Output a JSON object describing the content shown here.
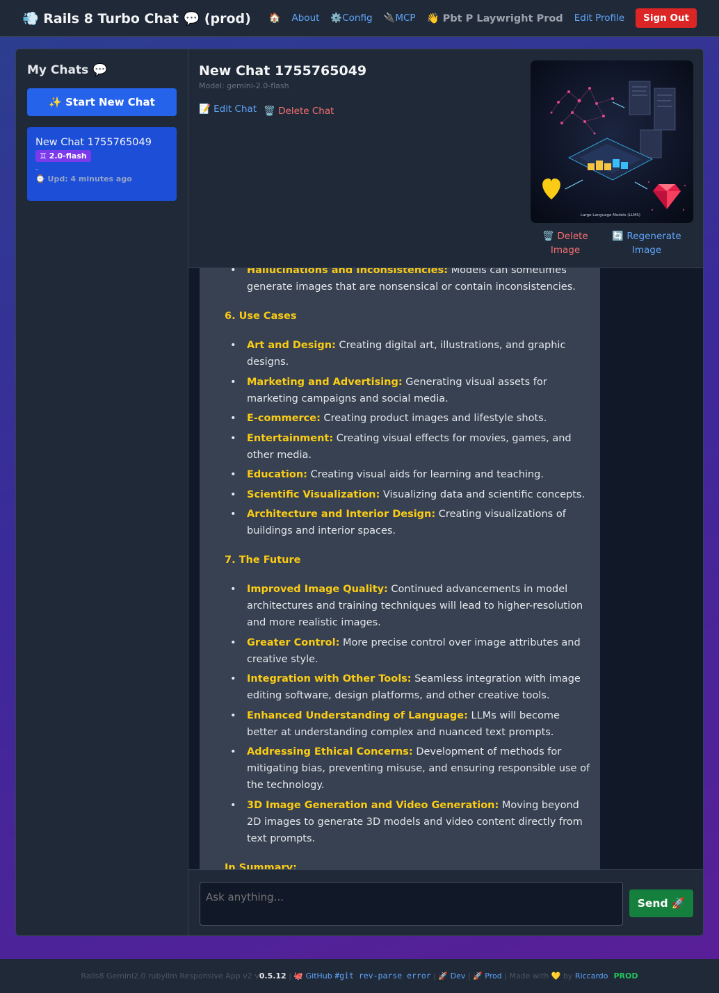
{
  "nav": {
    "brand": "💨 Rails 8 Turbo Chat 💬 (prod)",
    "home": "🏠",
    "about": "About",
    "config": "⚙️Config",
    "mcp": "🔌MCP",
    "user": "👋 Pbt P Laywright Prod",
    "edit_profile": "Edit Profile",
    "sign_out": "Sign Out"
  },
  "sidebar": {
    "title": "My Chats 💬",
    "new_chat": "✨ Start New Chat",
    "chats": [
      {
        "title": "New Chat 1755765049",
        "badge": "♊ 2.0-flash",
        "dash": "-",
        "updated": "⌚ Upd: 4 minutes ago"
      }
    ]
  },
  "chat": {
    "title": "New Chat 1755765049",
    "model": "Model: gemini-2.0-flash",
    "edit": "📝 Edit Chat",
    "delete": "🗑️ Delete Chat",
    "delete_image": "🗑️ Delete Image",
    "regenerate_image": "🔄 Regenerate Image",
    "image_caption": "Large Language Models (LLMS)"
  },
  "messages": {
    "items_top": [
      {
        "hl": "Hallucinations and Inconsistencies:",
        "text": " Models can sometimes generate images that are nonsensical or contain inconsistencies."
      }
    ],
    "h_use_cases": "6. Use Cases",
    "use_cases": [
      {
        "hl": "Art and Design:",
        "text": " Creating digital art, illustrations, and graphic designs."
      },
      {
        "hl": "Marketing and Advertising:",
        "text": " Generating visual assets for marketing campaigns and social media."
      },
      {
        "hl": "E-commerce:",
        "text": " Creating product images and lifestyle shots."
      },
      {
        "hl": "Entertainment:",
        "text": " Creating visual effects for movies, games, and other media."
      },
      {
        "hl": "Education:",
        "text": " Creating visual aids for learning and teaching."
      },
      {
        "hl": "Scientific Visualization:",
        "text": " Visualizing data and scientific concepts."
      },
      {
        "hl": "Architecture and Interior Design:",
        "text": " Creating visualizations of buildings and interior spaces."
      }
    ],
    "h_future": "7. The Future",
    "future": [
      {
        "hl": "Improved Image Quality:",
        "text": " Continued advancements in model architectures and training techniques will lead to higher-resolution and more realistic images."
      },
      {
        "hl": "Greater Control:",
        "text": " More precise control over image attributes and creative style."
      },
      {
        "hl": "Integration with Other Tools:",
        "text": " Seamless integration with image editing software, design platforms, and other creative tools."
      },
      {
        "hl": "Enhanced Understanding of Language:",
        "text": " LLMs will become better at understanding complex and nuanced text prompts."
      },
      {
        "hl": "Addressing Ethical Concerns:",
        "text": " Development of methods for mitigating bias, preventing misuse, and ensuring responsible use of the technology."
      },
      {
        "hl": "3D Image Generation and Video Generation:",
        "text": " Moving beyond 2D images to generate 3D models and video content directly from text prompts."
      }
    ],
    "h_summary": "In Summary:"
  },
  "input": {
    "placeholder": "Ask anything...",
    "send": "Send 🚀"
  },
  "footer": {
    "prefix": "Rails8 Gemini2.0 rubyllm Responsive App v2 v",
    "version": "0.5.12",
    "sep1": " | ",
    "github": "🐙 GitHub",
    "git_code": "#git rev-parse error",
    "dev": "🚀 Dev",
    "prod": "🚀 Prod",
    "made_with": " | Made with 💛 by ",
    "author": "Riccardo",
    "env": "PROD"
  }
}
